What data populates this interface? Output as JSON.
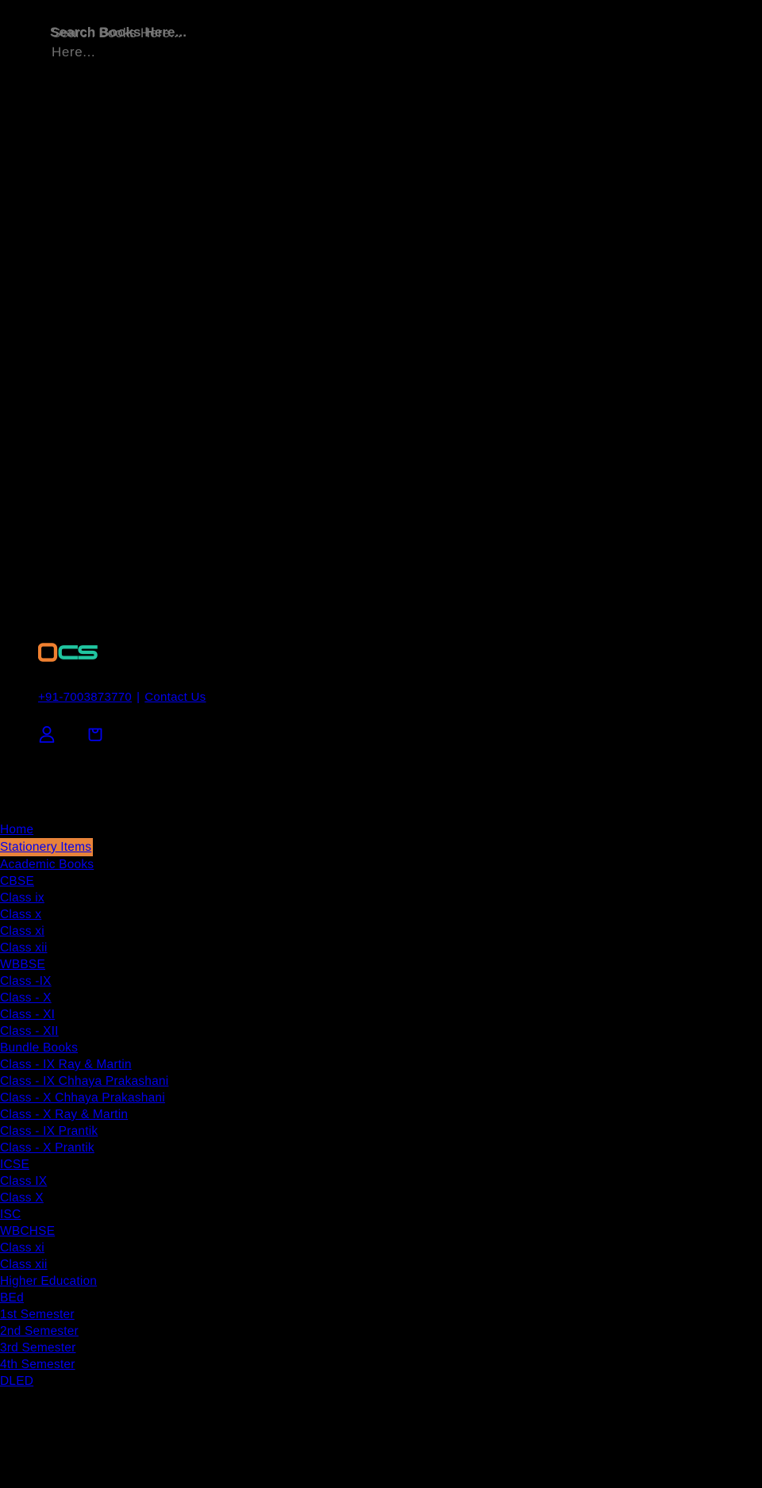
{
  "search": {
    "primary_placeholder": "Search Books Here...",
    "ghost_placeholder": "Search Books Here...",
    "wrapped_fragment": "Here..."
  },
  "brand": {
    "logo_text": "OCS",
    "logo_letter_1": "O",
    "logo_letters_2": "CS",
    "logo_color_primary": "#f08030",
    "logo_color_secondary": "#20c5a0"
  },
  "header": {
    "phone": "+91-7003873770",
    "separator": "|",
    "contact_label": "Contact Us",
    "account_icon": "user-icon",
    "cart_icon": "shopping-bag-icon",
    "link_color": "#0000ee"
  },
  "nav": {
    "highlight_color": "#e8833a",
    "items": [
      {
        "label": "Home",
        "level": 0,
        "highlighted": false
      },
      {
        "label": "Stationery Items",
        "level": 0,
        "highlighted": true
      },
      {
        "label": "Academic Books",
        "level": 0,
        "highlighted": false
      },
      {
        "label": "CBSE",
        "level": 1,
        "highlighted": false
      },
      {
        "label": "Class ix",
        "level": 1,
        "highlighted": false
      },
      {
        "label": "Class x",
        "level": 1,
        "highlighted": false
      },
      {
        "label": "Class xi",
        "level": 1,
        "highlighted": false
      },
      {
        "label": "Class xii",
        "level": 1,
        "highlighted": false
      },
      {
        "label": "WBBSE",
        "level": 1,
        "highlighted": false
      },
      {
        "label": "Class -IX",
        "level": 1,
        "highlighted": false
      },
      {
        "label": "Class - X",
        "level": 1,
        "highlighted": false
      },
      {
        "label": "Class - XI",
        "level": 1,
        "highlighted": false
      },
      {
        "label": "Class - XII",
        "level": 1,
        "highlighted": false
      },
      {
        "label": "Bundle Books",
        "level": 1,
        "highlighted": false
      },
      {
        "label": "Class - IX Ray & Martin",
        "level": 1,
        "highlighted": false
      },
      {
        "label": "Class - IX Chhaya Prakashani",
        "level": 1,
        "highlighted": false
      },
      {
        "label": "Class - X Chhaya Prakashani",
        "level": 1,
        "highlighted": false
      },
      {
        "label": "Class - X Ray & Martin",
        "level": 1,
        "highlighted": false
      },
      {
        "label": "Class - IX Prantik",
        "level": 1,
        "highlighted": false
      },
      {
        "label": "Class - X Prantik",
        "level": 1,
        "highlighted": false
      },
      {
        "label": "ICSE",
        "level": 1,
        "highlighted": false
      },
      {
        "label": "Class IX",
        "level": 1,
        "highlighted": false
      },
      {
        "label": "Class X",
        "level": 1,
        "highlighted": false
      },
      {
        "label": "ISC",
        "level": 1,
        "highlighted": false
      },
      {
        "label": "WBCHSE",
        "level": 1,
        "highlighted": false
      },
      {
        "label": "Class xi",
        "level": 1,
        "highlighted": false
      },
      {
        "label": "Class xii",
        "level": 1,
        "highlighted": false
      },
      {
        "label": "Higher Education",
        "level": 0,
        "highlighted": false
      },
      {
        "label": "BEd",
        "level": 1,
        "highlighted": false
      },
      {
        "label": "1st Semester",
        "level": 1,
        "highlighted": false
      },
      {
        "label": "2nd Semester",
        "level": 1,
        "highlighted": false
      },
      {
        "label": "3rd Semester",
        "level": 1,
        "highlighted": false
      },
      {
        "label": "4th Semester",
        "level": 1,
        "highlighted": false
      },
      {
        "label": "DLED",
        "level": 1,
        "highlighted": false
      }
    ]
  }
}
